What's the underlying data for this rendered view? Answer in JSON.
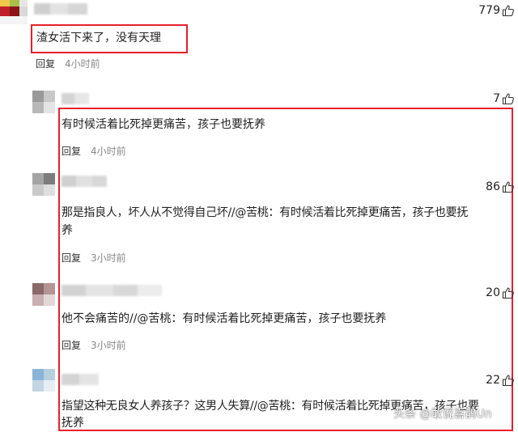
{
  "top_comment": {
    "text": "渣女活下来了，没有天理",
    "reply_label": "回复",
    "time": "4小时前",
    "likes": "779"
  },
  "replies": [
    {
      "text": "有时候活着比死掉更痛苦，孩子也要抚养",
      "text_line2": "",
      "reply_label": "回复",
      "time": "4小时前",
      "likes": "7"
    },
    {
      "text": "那是指良人，坏人从不觉得自己坏//@苦桃：有时候活着比死掉更痛苦，孩子也要抚",
      "text_line2": "养",
      "reply_label": "回复",
      "time": "3小时前",
      "likes": "86"
    },
    {
      "text": "他不会痛苦的//@苦桃：有时候活着比死掉更痛苦，孩子也要抚养",
      "text_line2": "",
      "reply_label": "回复",
      "time": "3小时前",
      "likes": "20"
    },
    {
      "text": "指望这种无良女人养孩子？这男人失算//@苦桃：有时候活着比死掉更痛苦，孩子也要",
      "text_line2": "抚养",
      "reply_label": "",
      "time": "",
      "likes": "22"
    }
  ],
  "watermark": "头条 @敢说喜鹊Un",
  "colors": {
    "highlight": "#e8202a",
    "meta_time": "#888888"
  },
  "icons": {
    "like": "thumbs-up-icon"
  }
}
